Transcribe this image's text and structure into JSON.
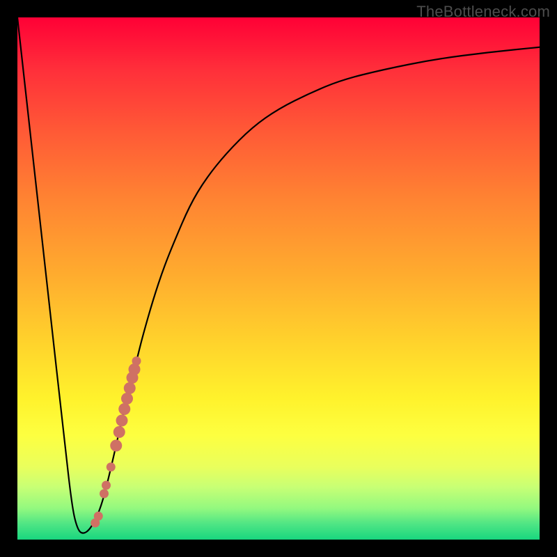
{
  "watermark": "TheBottleneck.com",
  "colors": {
    "background": "#000000",
    "curve": "#000000",
    "dot_fill": "#cf7164",
    "dot_stroke": "#b95a4f"
  },
  "chart_data": {
    "type": "line",
    "title": "",
    "xlabel": "",
    "ylabel": "",
    "xlim": [
      0,
      100
    ],
    "ylim": [
      0,
      100
    ],
    "series": [
      {
        "name": "bottleneck-curve",
        "x": [
          0,
          3,
          6,
          9,
          10.5,
          11.5,
          12.5,
          14,
          16,
          18,
          20,
          21,
          22,
          23,
          24,
          26,
          28,
          30,
          33,
          36,
          40,
          45,
          50,
          56,
          62,
          70,
          80,
          90,
          100
        ],
        "y": [
          100,
          73,
          46,
          19,
          6,
          2,
          1,
          2,
          6,
          14,
          23,
          27,
          31,
          35,
          39,
          46,
          52,
          57,
          64,
          69,
          74,
          79,
          82.5,
          85.5,
          88,
          90,
          92,
          93.3,
          94.3
        ]
      }
    ],
    "points": {
      "name": "highlight-dots",
      "x_range": [
        15.2,
        22.8
      ],
      "y_range": [
        2,
        35
      ],
      "coords": [
        [
          14.9,
          3.2
        ],
        [
          15.5,
          4.5
        ],
        [
          16.6,
          8.8
        ],
        [
          17.0,
          10.4
        ],
        [
          17.9,
          13.9
        ],
        [
          18.9,
          18.0
        ],
        [
          19.5,
          20.6
        ],
        [
          20.0,
          22.8
        ],
        [
          20.5,
          25.0
        ],
        [
          21.0,
          27.0
        ],
        [
          21.5,
          29.0
        ],
        [
          22.0,
          31.0
        ],
        [
          22.4,
          32.6
        ],
        [
          22.8,
          34.2
        ]
      ]
    }
  }
}
